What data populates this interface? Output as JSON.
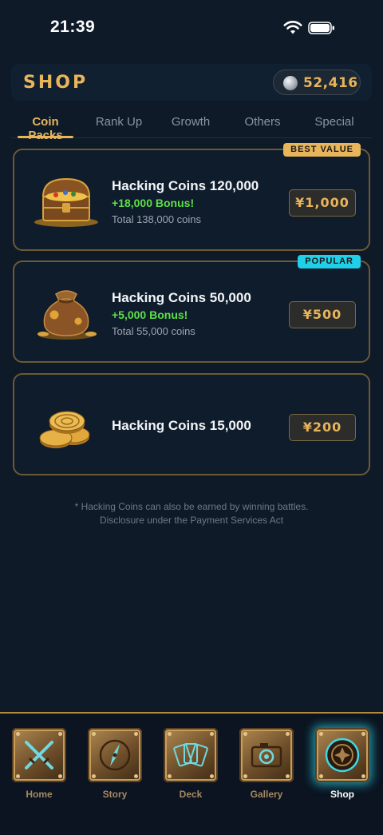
{
  "status": {
    "time": "21:39"
  },
  "header": {
    "title": "SHOP",
    "balance": "52,416",
    "coin_icon": "silver-coin-icon"
  },
  "tabs": [
    {
      "label": "Coin Packs",
      "active": true
    },
    {
      "label": "Rank Up",
      "active": false
    },
    {
      "label": "Growth",
      "active": false
    },
    {
      "label": "Others",
      "active": false
    },
    {
      "label": "Special",
      "active": false
    }
  ],
  "products": [
    {
      "badge": "BEST VALUE",
      "name": "Hacking Coins 120,000",
      "bonus": "+18,000 Bonus!",
      "total": "Total 138,000 coins",
      "price": "¥1,000",
      "icon": "treasure-chest-icon"
    },
    {
      "badge": "POPULAR",
      "name": "Hacking Coins 50,000",
      "bonus": "+5,000 Bonus!",
      "total": "Total 55,000 coins",
      "price": "¥500",
      "icon": "coin-bag-icon"
    },
    {
      "badge": "",
      "name": "Hacking Coins 15,000",
      "bonus": "",
      "total": "",
      "price": "¥200",
      "icon": "coin-stack-icon"
    }
  ],
  "footnote": {
    "line1": "* Hacking Coins can also be earned by winning battles.",
    "line2": "Disclosure under the Payment Services Act"
  },
  "nav": [
    {
      "label": "Home",
      "icon": "crossed-swords-icon",
      "active": false
    },
    {
      "label": "Story",
      "icon": "compass-icon",
      "active": false
    },
    {
      "label": "Deck",
      "icon": "cards-icon",
      "active": false
    },
    {
      "label": "Gallery",
      "icon": "camera-icon",
      "active": false
    },
    {
      "label": "Shop",
      "icon": "coin-emblem-icon",
      "active": true
    }
  ],
  "colors": {
    "accent": "#e8b55a",
    "bonus": "#5de04a",
    "popular": "#1fd0e8",
    "background": "#0e1a28"
  }
}
